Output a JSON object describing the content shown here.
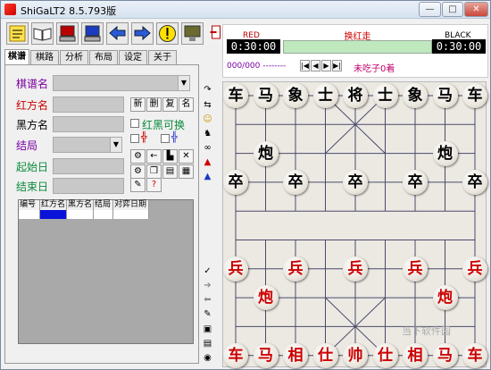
{
  "window": {
    "title": "ShiGaLT2 8.5.793版",
    "controls": {
      "min": "—",
      "max": "□",
      "close": "✕"
    }
  },
  "toolbar": {
    "buttons": [
      {
        "name": "notes-button"
      },
      {
        "name": "book-button"
      },
      {
        "name": "computer-red-button"
      },
      {
        "name": "computer-blue-button"
      },
      {
        "name": "back-arrow-button"
      },
      {
        "name": "forward-arrow-button"
      },
      {
        "name": "warning-button"
      },
      {
        "name": "monitor-button"
      }
    ]
  },
  "tabs": [
    "棋谱",
    "棋路",
    "分析",
    "布局",
    "设定",
    "关于"
  ],
  "form": {
    "record_name": "棋谱名",
    "red_name": "红方名",
    "black_name": "黑方名",
    "result": "结局",
    "start_date": "起始日",
    "end_date": "结束日",
    "btn_new": "新",
    "btn_delete": "删",
    "btn_copy": "复",
    "btn_rename": "名",
    "swap_label": "红黑可换",
    "red_tag": "╬",
    "black_tag": "╬"
  },
  "grid": {
    "headers": [
      "编号",
      "红方名",
      "黑方名",
      "结局",
      "对弈日期"
    ]
  },
  "info": {
    "red_label": "RED",
    "black_label": "BLACK",
    "red_clock": "0:30:00",
    "black_clock": "0:30:00",
    "turn": "换红走",
    "move_counter": "000/000 --------",
    "nav": [
      "|◀",
      "◀",
      "▶",
      "▶|"
    ],
    "status": "未吃子0着"
  },
  "board": {
    "pieces": [
      {
        "t": "车",
        "c": "b",
        "col": 0,
        "row": 0
      },
      {
        "t": "马",
        "c": "b",
        "col": 1,
        "row": 0
      },
      {
        "t": "象",
        "c": "b",
        "col": 2,
        "row": 0
      },
      {
        "t": "士",
        "c": "b",
        "col": 3,
        "row": 0
      },
      {
        "t": "将",
        "c": "b",
        "col": 4,
        "row": 0
      },
      {
        "t": "士",
        "c": "b",
        "col": 5,
        "row": 0
      },
      {
        "t": "象",
        "c": "b",
        "col": 6,
        "row": 0
      },
      {
        "t": "马",
        "c": "b",
        "col": 7,
        "row": 0
      },
      {
        "t": "车",
        "c": "b",
        "col": 8,
        "row": 0
      },
      {
        "t": "炮",
        "c": "b",
        "col": 1,
        "row": 2
      },
      {
        "t": "炮",
        "c": "b",
        "col": 7,
        "row": 2
      },
      {
        "t": "卒",
        "c": "b",
        "col": 0,
        "row": 3
      },
      {
        "t": "卒",
        "c": "b",
        "col": 2,
        "row": 3
      },
      {
        "t": "卒",
        "c": "b",
        "col": 4,
        "row": 3
      },
      {
        "t": "卒",
        "c": "b",
        "col": 6,
        "row": 3
      },
      {
        "t": "卒",
        "c": "b",
        "col": 8,
        "row": 3
      },
      {
        "t": "兵",
        "c": "r",
        "col": 0,
        "row": 6
      },
      {
        "t": "兵",
        "c": "r",
        "col": 2,
        "row": 6
      },
      {
        "t": "兵",
        "c": "r",
        "col": 4,
        "row": 6
      },
      {
        "t": "兵",
        "c": "r",
        "col": 6,
        "row": 6
      },
      {
        "t": "兵",
        "c": "r",
        "col": 8,
        "row": 6
      },
      {
        "t": "炮",
        "c": "r",
        "col": 1,
        "row": 7
      },
      {
        "t": "炮",
        "c": "r",
        "col": 7,
        "row": 7
      },
      {
        "t": "车",
        "c": "r",
        "col": 0,
        "row": 9
      },
      {
        "t": "马",
        "c": "r",
        "col": 1,
        "row": 9
      },
      {
        "t": "相",
        "c": "r",
        "col": 2,
        "row": 9
      },
      {
        "t": "仕",
        "c": "r",
        "col": 3,
        "row": 9
      },
      {
        "t": "帅",
        "c": "r",
        "col": 4,
        "row": 9
      },
      {
        "t": "仕",
        "c": "r",
        "col": 5,
        "row": 9
      },
      {
        "t": "相",
        "c": "r",
        "col": 6,
        "row": 9
      },
      {
        "t": "马",
        "c": "r",
        "col": 7,
        "row": 9
      },
      {
        "t": "车",
        "c": "r",
        "col": 8,
        "row": 9
      }
    ]
  },
  "watermark": "当下软件园"
}
